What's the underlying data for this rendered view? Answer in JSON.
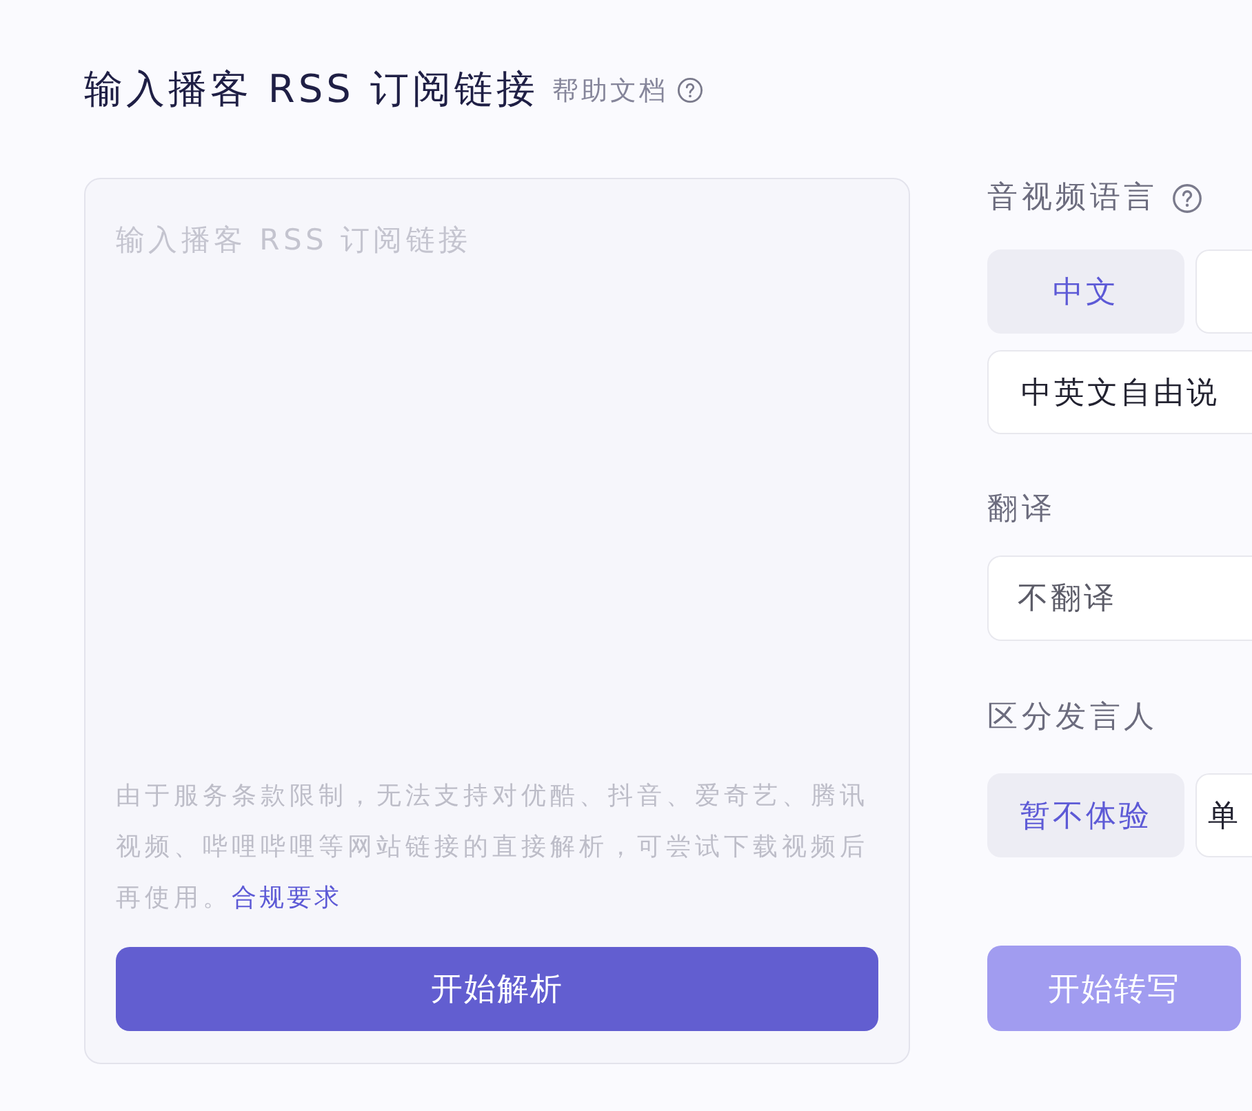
{
  "header": {
    "title": "输入播客 RSS 订阅链接",
    "help_link": "帮助文档"
  },
  "input_card": {
    "placeholder": "输入播客 RSS 订阅链接",
    "notice": "由于服务条款限制，无法支持对优酷、抖音、爱奇艺、腾讯视频、哔哩哔哩等网站链接的直接解析，可尝试下载视频后再使用。",
    "notice_link": "合规要求",
    "button": "开始解析"
  },
  "settings": {
    "language": {
      "label": "音视频语言",
      "option_rows": [
        [
          {
            "label": "中文",
            "selected": true
          },
          {
            "selected": false
          }
        ],
        [
          {
            "label": "中英文自由说",
            "selected": false
          }
        ]
      ]
    },
    "translation": {
      "label": "翻译",
      "value": "不翻译"
    },
    "speakers": {
      "label": "区分发言人",
      "option_rows": [
        [
          {
            "label": "暂不体验",
            "selected": true
          },
          {
            "label": "单",
            "selected": false
          }
        ]
      ]
    }
  },
  "start_button": {
    "label": "开始转写",
    "disabled": true
  }
}
